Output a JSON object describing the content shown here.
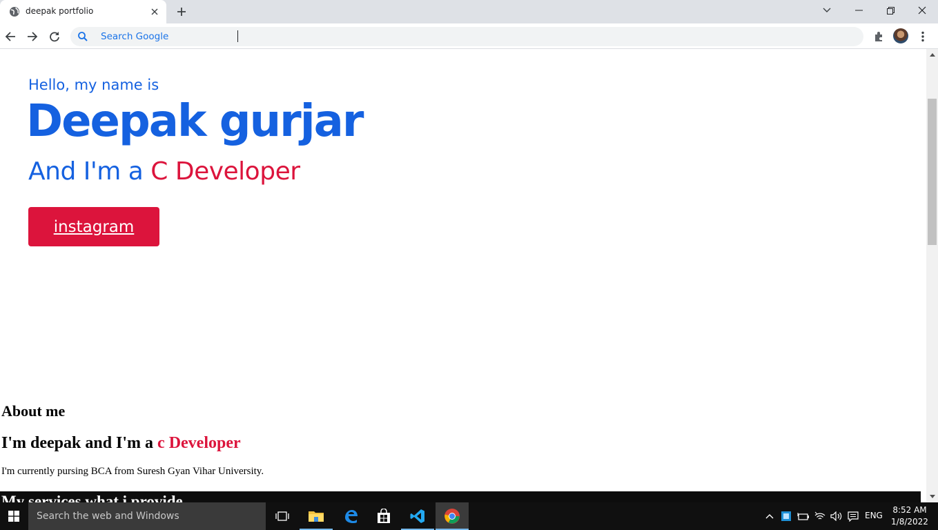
{
  "browser": {
    "tab_title": "deepak portfolio",
    "omnibox_placeholder": "Search Google"
  },
  "page": {
    "greeting": "Hello, my name is",
    "name": "Deepak gurjar",
    "role_prefix": "And I'm a ",
    "role_accent": "C Developer",
    "cta_label": "instagram",
    "about_title": "About me",
    "about_sub_prefix": "I'm deepak and I'm a ",
    "about_sub_accent": "c Developer",
    "about_text": "I'm currently pursing BCA from Suresh Gyan Vihar University.",
    "services_title": "My services what i provide",
    "colors": {
      "primary": "#1561e0",
      "accent": "#dc143c",
      "dark": "#0d0d0d"
    }
  },
  "taskbar": {
    "search_placeholder": "Search the web and Windows",
    "language": "ENG",
    "time": "8:52 AM",
    "date": "1/8/2022",
    "apps": [
      "task-view-icon",
      "file-explorer-icon",
      "edge-icon",
      "store-icon",
      "vscode-icon",
      "chrome-icon"
    ]
  }
}
